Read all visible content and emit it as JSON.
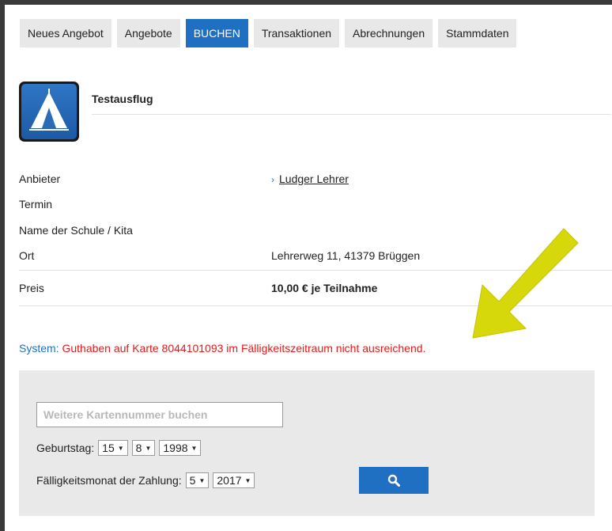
{
  "nav": {
    "tabs": [
      {
        "label": "Neues Angebot"
      },
      {
        "label": "Angebote"
      },
      {
        "label": "BUCHEN"
      },
      {
        "label": "Transaktionen"
      },
      {
        "label": "Abrechnungen"
      },
      {
        "label": "Stammdaten"
      }
    ],
    "active_tab": "BUCHEN"
  },
  "offer": {
    "icon": "tent-icon",
    "title": "Testausflug"
  },
  "details": {
    "anbieter": {
      "label": "Anbieter",
      "value": "Ludger Lehrer"
    },
    "termin": {
      "label": "Termin",
      "value": ""
    },
    "schule": {
      "label": "Name der Schule / Kita",
      "value": ""
    },
    "ort": {
      "label": "Ort",
      "value": "Lehrerweg 11, 41379 Brüggen"
    },
    "preis": {
      "label": "Preis",
      "value": "10,00 € je Teilnahme"
    }
  },
  "system_message": {
    "prefix": "System:",
    "text": "Guthaben auf Karte 8044101093 im Fälligkeitszeitraum nicht ausreichend."
  },
  "form": {
    "card_placeholder": "Weitere Kartennummer buchen",
    "card_value": "",
    "birthday_label": "Geburtstag:",
    "birthday_day": "15",
    "birthday_month": "8",
    "birthday_year": "1998",
    "due_label": "Fälligkeitsmonat der Zahlung:",
    "due_month": "5",
    "due_year": "2017",
    "search_icon": "search-icon"
  },
  "colors": {
    "accent": "#1f6fc2",
    "error": "#e21b1b",
    "panel": "#e9e9e9",
    "arrow": "#d7d80c"
  }
}
